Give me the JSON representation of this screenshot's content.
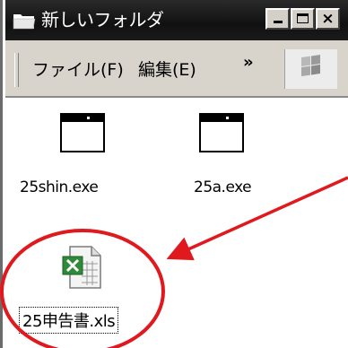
{
  "window": {
    "title": "新しいフォルダ",
    "controls": {
      "minimize": "_",
      "maximize": "□",
      "close": "×"
    }
  },
  "menubar": {
    "items": [
      {
        "label": "ファイル(F)"
      },
      {
        "label": "編集(E)"
      }
    ],
    "overflow": "»"
  },
  "files": [
    {
      "name": "25shin.exe",
      "type": "exe"
    },
    {
      "name": "25a.exe",
      "type": "exe"
    },
    {
      "name": "25申告書.xls",
      "type": "xls"
    }
  ],
  "colors": {
    "titlebar": "#111111",
    "annotation": "#e0191e",
    "excel_green": "#2f8a3a"
  }
}
